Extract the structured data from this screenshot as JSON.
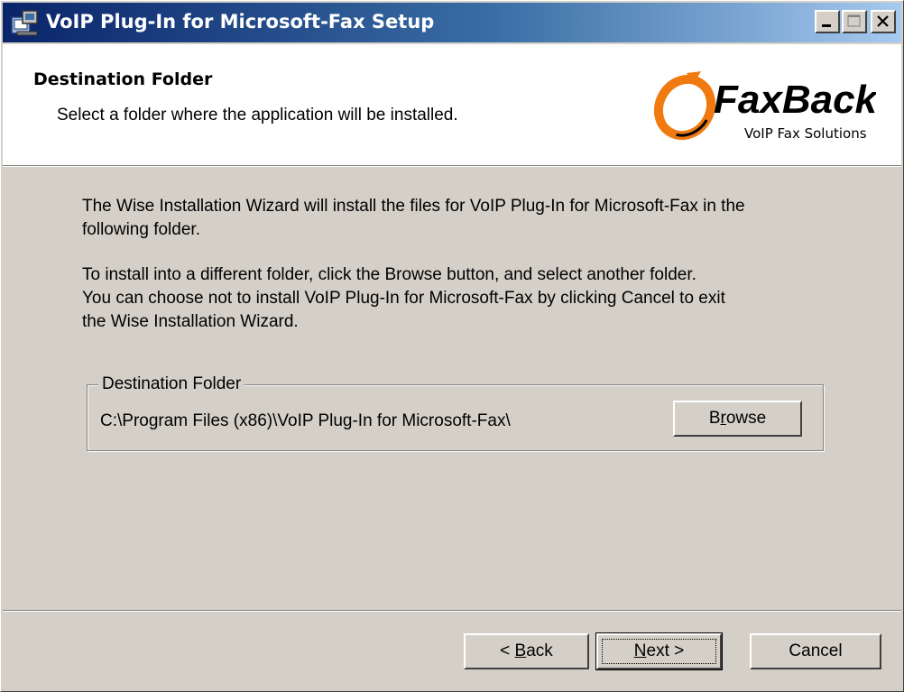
{
  "window": {
    "title": "VoIP Plug-In for Microsoft-Fax Setup"
  },
  "header": {
    "title": "Destination Folder",
    "subtitle": "Select a folder where the application will be installed.",
    "logo": {
      "name": "FaxBack",
      "tagline": "VoIP Fax Solutions"
    }
  },
  "body": {
    "para1_line1": "The Wise Installation Wizard will install the files for VoIP Plug-In for Microsoft-Fax in the",
    "para1_line2": "following folder.",
    "para2_line1": "To install into a different folder, click the Browse button, and select another folder.",
    "para2_line2": "You can choose not to install VoIP Plug-In for Microsoft-Fax by clicking Cancel to exit",
    "para2_line3": "the Wise Installation Wizard."
  },
  "destination": {
    "group_label": "Destination Folder",
    "path": "C:\\Program Files (x86)\\VoIP Plug-In for Microsoft-Fax\\",
    "browse_pre": "B",
    "browse_key": "r",
    "browse_post": "owse"
  },
  "footer": {
    "back_pre": "< ",
    "back_key": "B",
    "back_post": "ack",
    "next_key": "N",
    "next_post": "ext >",
    "cancel_label": "Cancel"
  },
  "colors": {
    "titlebar_start": "#0a246a",
    "titlebar_end": "#a6caf0",
    "dialog_bg": "#d4d0c8",
    "logo_orange": "#f07a10"
  }
}
